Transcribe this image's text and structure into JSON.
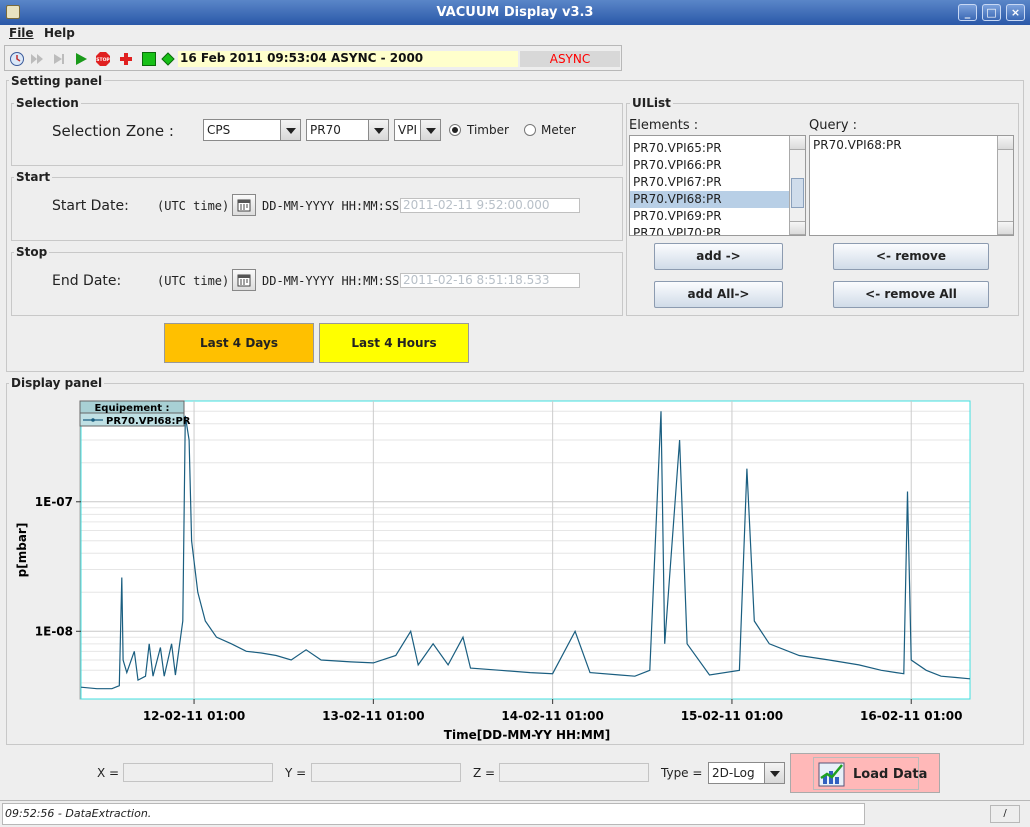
{
  "window": {
    "title": "VACUUM Display v3.3",
    "controls": [
      "_",
      "□",
      "×"
    ]
  },
  "menu": [
    {
      "label": "File",
      "mnemonic": "F"
    },
    {
      "label": "Help",
      "mnemonic": "H"
    }
  ],
  "toolbar": {
    "icons": [
      "clock-icon",
      "fast-forward-icon",
      "skip-icon",
      "play-icon",
      "stop-icon",
      "red-cross-icon",
      "green-square-icon",
      "green-diamond-icon"
    ],
    "datetime": "16 Feb 2011   09:53:04  ASYNC - 2000",
    "mode_badge": "ASYNC",
    "colors": {
      "datetime_bg": "#ffffcc",
      "badge_text": "#ff0000"
    }
  },
  "setting_panel": {
    "title": "Setting panel",
    "selection": {
      "title": "Selection",
      "zone_label": "Selection Zone :",
      "zone_value": "CPS",
      "sector_value": "PR70",
      "type_value": "VPI",
      "radio_timber": "Timber",
      "radio_meter": "Meter",
      "selected_radio": "Timber"
    },
    "start": {
      "title": "Start",
      "label": "Start Date:",
      "tz": "(UTC time)",
      "format": "DD-MM-YYYY HH:MM:SS",
      "value": "2011-02-11 9:52:00.000"
    },
    "stop": {
      "title": "Stop",
      "label": "End Date:",
      "tz": "(UTC time)",
      "format": "DD-MM-YYYY HH:MM:SS",
      "value": "2011-02-16 8:51:18.533"
    },
    "quick_buttons": {
      "last_days": "Last 4 Days",
      "last_hours": "Last 4 Hours",
      "colors": {
        "days": "#ffc000",
        "hours": "#ffff00"
      }
    },
    "uilist": {
      "title": "UIList",
      "elements_label": "Elements :",
      "query_label": "Query :",
      "elements": [
        "PR70.VPI65:PR",
        "PR70.VPI66:PR",
        "PR70.VPI67:PR",
        "PR70.VPI68:PR",
        "PR70.VPI69:PR",
        "PR70.VPI70:PR"
      ],
      "selected_element": "PR70.VPI68:PR",
      "query": [
        "PR70.VPI68:PR"
      ],
      "add": "add ->",
      "remove": "<- remove",
      "add_all": "add All->",
      "remove_all": "<- remove All"
    }
  },
  "display_panel": {
    "title": "Display panel",
    "legend_title": "Equipement :",
    "x_label": "Time[DD-MM-YY HH:MM]",
    "y_label": "p[mbar]",
    "x_ticks": [
      "12-02-11 01:00",
      "13-02-11 01:00",
      "14-02-11 01:00",
      "15-02-11 01:00",
      "16-02-11 01:00"
    ],
    "y_ticks": [
      "1E-07",
      "1E-08"
    ]
  },
  "chart_data": {
    "type": "line",
    "xlabel": "Time[DD-MM-YY HH:MM]",
    "ylabel": "p[mbar]",
    "yscale": "log",
    "xlim": [
      "2011-02-11 09:52",
      "2011-02-16 08:52"
    ],
    "ylim": [
      3e-09,
      6e-07
    ],
    "grid": true,
    "legend": "top-left",
    "series": [
      {
        "name": "PR70.VPI68:PR",
        "color": "#1a5e80",
        "points": [
          [
            "2011-02-11 09:52",
            3.7e-09
          ],
          [
            "2011-02-11 12:00",
            3.6e-09
          ],
          [
            "2011-02-11 14:00",
            3.6e-09
          ],
          [
            "2011-02-11 15:00",
            3.8e-09
          ],
          [
            "2011-02-11 15:20",
            2.6e-08
          ],
          [
            "2011-02-11 15:30",
            6e-09
          ],
          [
            "2011-02-11 16:00",
            4.8e-09
          ],
          [
            "2011-02-11 17:00",
            7e-09
          ],
          [
            "2011-02-11 17:30",
            4.2e-09
          ],
          [
            "2011-02-11 18:30",
            4.5e-09
          ],
          [
            "2011-02-11 19:00",
            8e-09
          ],
          [
            "2011-02-11 19:30",
            4.5e-09
          ],
          [
            "2011-02-11 20:30",
            7.5e-09
          ],
          [
            "2011-02-11 21:00",
            4.5e-09
          ],
          [
            "2011-02-11 22:00",
            8e-09
          ],
          [
            "2011-02-11 22:30",
            4.6e-09
          ],
          [
            "2011-02-11 23:30",
            1.2e-08
          ],
          [
            "2011-02-11 23:50",
            4.6e-07
          ],
          [
            "2011-02-12 00:20",
            3e-07
          ],
          [
            "2011-02-12 00:40",
            5e-08
          ],
          [
            "2011-02-12 01:30",
            2e-08
          ],
          [
            "2011-02-12 02:30",
            1.2e-08
          ],
          [
            "2011-02-12 04:00",
            9e-09
          ],
          [
            "2011-02-12 06:00",
            8e-09
          ],
          [
            "2011-02-12 08:00",
            7e-09
          ],
          [
            "2011-02-12 10:00",
            6.8e-09
          ],
          [
            "2011-02-12 12:00",
            6.5e-09
          ],
          [
            "2011-02-12 14:00",
            6e-09
          ],
          [
            "2011-02-12 16:00",
            7.2e-09
          ],
          [
            "2011-02-12 18:00",
            6e-09
          ],
          [
            "2011-02-12 22:00",
            5.8e-09
          ],
          [
            "2011-02-13 01:00",
            5.7e-09
          ],
          [
            "2011-02-13 04:00",
            6.5e-09
          ],
          [
            "2011-02-13 06:00",
            1e-08
          ],
          [
            "2011-02-13 07:00",
            5.5e-09
          ],
          [
            "2011-02-13 09:00",
            8e-09
          ],
          [
            "2011-02-13 11:00",
            5.5e-09
          ],
          [
            "2011-02-13 13:00",
            9e-09
          ],
          [
            "2011-02-13 14:00",
            5.2e-09
          ],
          [
            "2011-02-13 18:00",
            5e-09
          ],
          [
            "2011-02-13 22:00",
            4.8e-09
          ],
          [
            "2011-02-14 01:00",
            4.7e-09
          ],
          [
            "2011-02-14 04:00",
            1e-08
          ],
          [
            "2011-02-14 06:00",
            4.8e-09
          ],
          [
            "2011-02-14 10:00",
            4.6e-09
          ],
          [
            "2011-02-14 12:00",
            4.5e-09
          ],
          [
            "2011-02-14 14:00",
            5e-09
          ],
          [
            "2011-02-14 15:30",
            5e-07
          ],
          [
            "2011-02-14 16:00",
            8e-09
          ],
          [
            "2011-02-14 18:00",
            3e-07
          ],
          [
            "2011-02-14 19:00",
            8e-09
          ],
          [
            "2011-02-14 22:00",
            4.6e-09
          ],
          [
            "2011-02-15 02:00",
            5e-09
          ],
          [
            "2011-02-15 03:00",
            1.8e-07
          ],
          [
            "2011-02-15 04:00",
            1.2e-08
          ],
          [
            "2011-02-15 06:00",
            8e-09
          ],
          [
            "2011-02-15 10:00",
            6.5e-09
          ],
          [
            "2011-02-15 14:00",
            6e-09
          ],
          [
            "2011-02-15 18:00",
            5.5e-09
          ],
          [
            "2011-02-15 21:00",
            5e-09
          ],
          [
            "2011-02-15 23:00",
            4.8e-09
          ],
          [
            "2011-02-16 00:00",
            4.7e-09
          ],
          [
            "2011-02-16 00:30",
            1.2e-07
          ],
          [
            "2011-02-16 01:00",
            6e-09
          ],
          [
            "2011-02-16 03:00",
            5e-09
          ],
          [
            "2011-02-16 05:00",
            4.5e-09
          ],
          [
            "2011-02-16 07:00",
            4.4e-09
          ],
          [
            "2011-02-16 08:52",
            4.3e-09
          ]
        ]
      }
    ]
  },
  "bottom": {
    "x_label": "X =",
    "y_label": "Y =",
    "z_label": "Z =",
    "type_label": "Type =",
    "type_value": "2D-Log",
    "load_button": "Load Data",
    "load_color": "#ffb8b8"
  },
  "status": {
    "message": "09:52:56 - DataExtraction.",
    "corner": "/"
  }
}
